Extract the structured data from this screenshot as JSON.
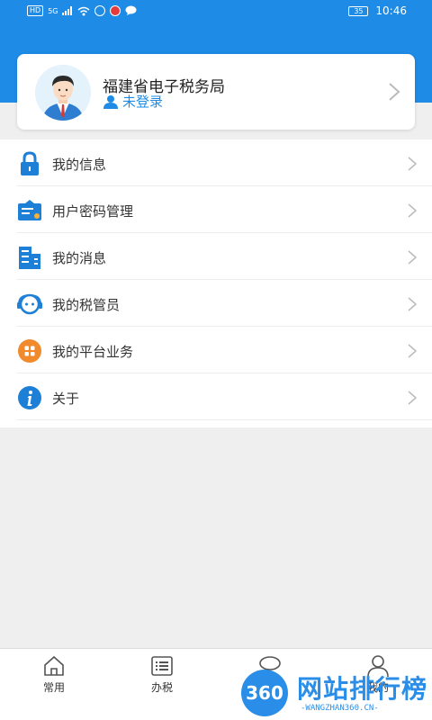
{
  "status_bar": {
    "network_label": "HD",
    "signal_label": "5G",
    "battery": "35",
    "time": "10:46"
  },
  "profile": {
    "title": "福建省电子税务局",
    "login_status": "未登录"
  },
  "menu": {
    "items": [
      {
        "label": "我的信息",
        "icon": "lock-icon"
      },
      {
        "label": "用户密码管理",
        "icon": "password-card-icon"
      },
      {
        "label": "我的消息",
        "icon": "message-building-icon"
      },
      {
        "label": "我的税管员",
        "icon": "tax-officer-icon"
      },
      {
        "label": "我的平台业务",
        "icon": "platform-apps-icon"
      },
      {
        "label": "关于",
        "icon": "info-icon"
      }
    ]
  },
  "tabbar": {
    "tabs": [
      {
        "label": "常用",
        "icon": "home-icon"
      },
      {
        "label": "办税",
        "icon": "list-icon"
      },
      {
        "label": "",
        "icon": "chat-icon"
      },
      {
        "label": "我的",
        "icon": "user-icon"
      }
    ]
  },
  "watermark": {
    "badge": "360",
    "title": "网站排行榜",
    "subtitle": "-WANGZHAN360.CN-"
  },
  "colors": {
    "primary": "#1e8be6",
    "background": "#efefef",
    "orange": "#f08a2c"
  }
}
